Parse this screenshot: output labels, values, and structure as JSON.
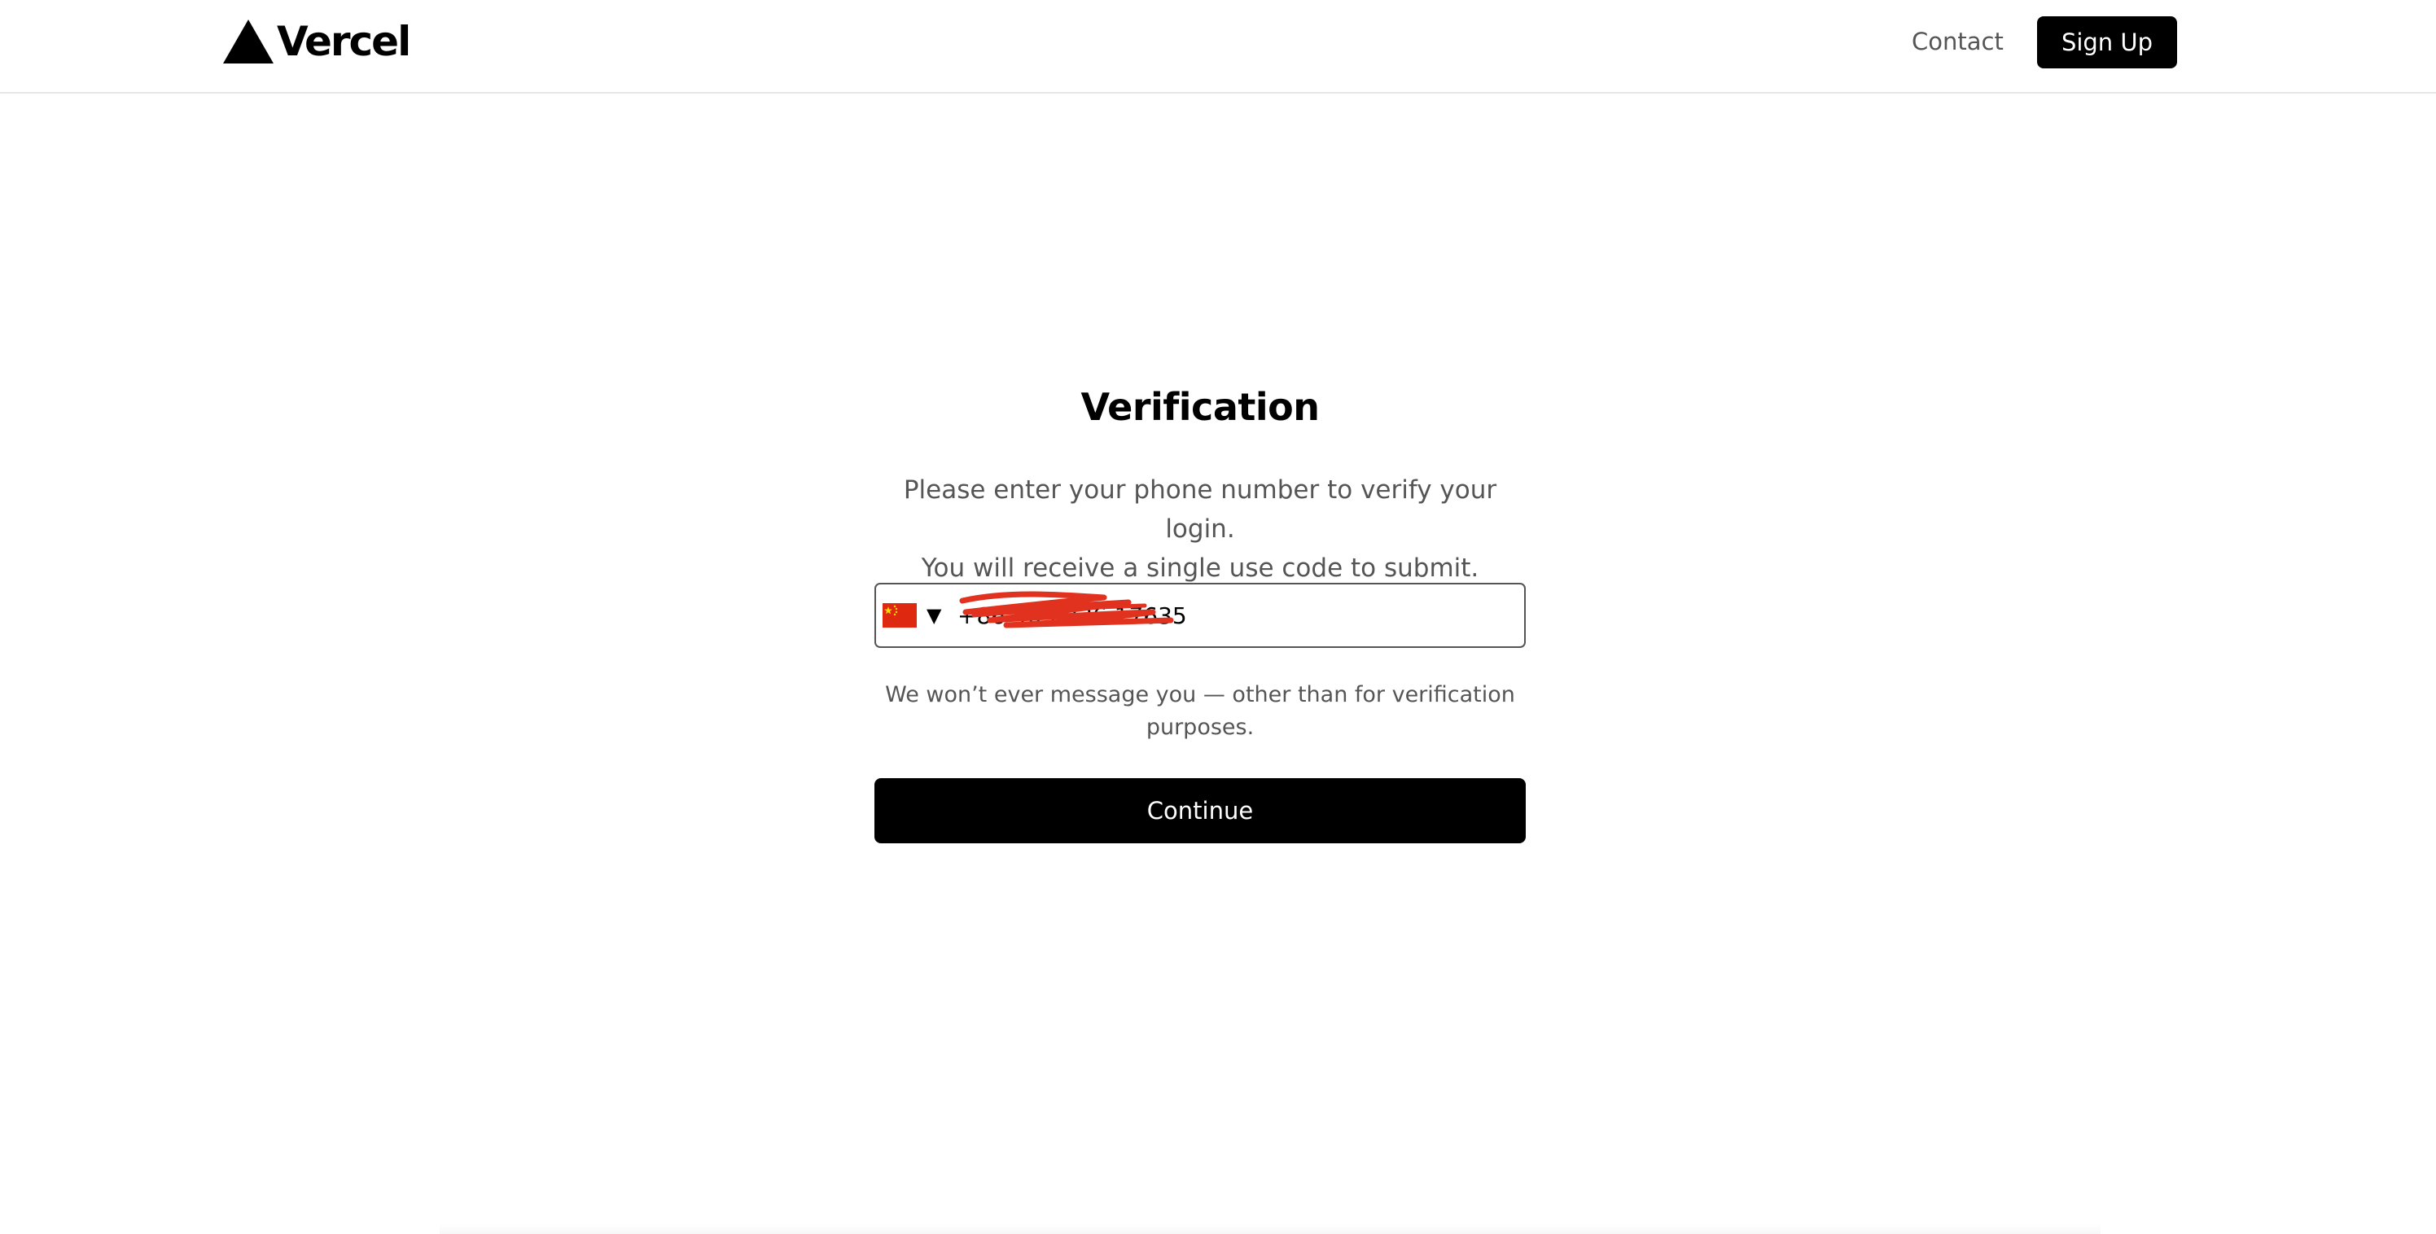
{
  "header": {
    "logo_text": "Vercel",
    "contact_label": "Contact",
    "signup_label": "Sign Up"
  },
  "verification": {
    "title": "Verification",
    "description_line1": "Please enter your phone number to verify your login.",
    "description_line2": "You will receive a single use code to submit.",
    "phone": {
      "country_flag": "china-flag-icon",
      "country_code": "CN",
      "value": "+86 405 336 17635",
      "redacted": true
    },
    "note": "We won’t ever message you — other than for verification purposes.",
    "continue_label": "Continue"
  },
  "colors": {
    "primary": "#000000",
    "muted_text": "#555555",
    "border": "#555555",
    "divider": "#e6e6e6",
    "flag_red": "#de2910",
    "flag_yellow": "#ffde00",
    "redaction": "#e0321e"
  }
}
